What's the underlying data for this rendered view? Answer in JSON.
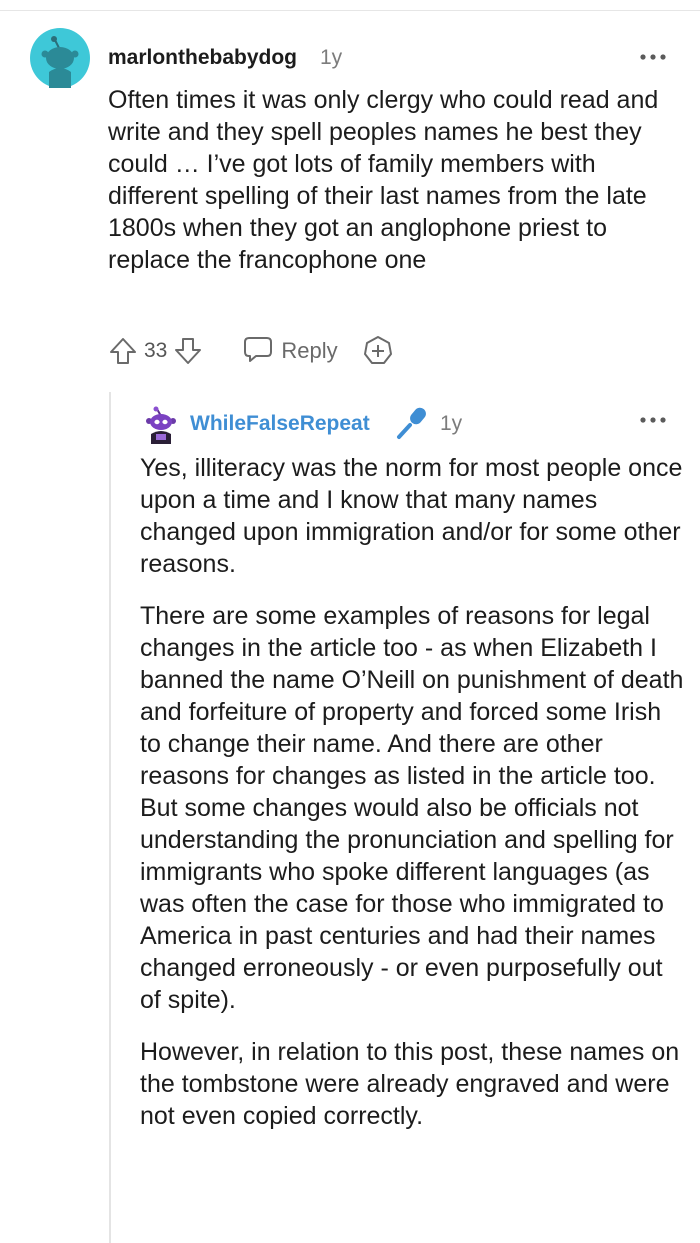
{
  "comment": {
    "avatar_icon": "snoo-avatar-icon",
    "avatar_color": "#3ec8d8",
    "username": "marlonthebabydog",
    "age": "1y",
    "more_icon": "more-options-icon",
    "body": "Often times it was only clergy who could read and write and they spell peoples names he best they could … I’ve got lots of family members with different spelling of their last names from the late 1800s when they got an anglophone priest to replace the francophone one",
    "upvote_icon": "upvote-arrow-icon",
    "vote_count": "33",
    "downvote_icon": "downvote-arrow-icon",
    "reply_icon": "speech-bubble-icon",
    "reply_label": "Reply",
    "award_icon": "award-plus-icon"
  },
  "reply": {
    "avatar_icon": "purple-snoo-avatar-icon",
    "username": "WhileFalseRepeat",
    "username_color": "#3f8ed4",
    "flair_icon": "microphone-icon",
    "age": "1y",
    "more_icon": "more-options-icon",
    "paragraphs": [
      "Yes, illiteracy was the norm for most people once upon a time and I know that many names changed upon immigration and/or for some other reasons.",
      "There are some examples of reasons for legal changes in the article too - as when Elizabeth I banned the name O’Neill on punishment of death and forfeiture of property and forced some Irish to change their name. And there are other reasons for changes as listed in the article too. But some changes would also be officials not understanding the pronunciation and spelling for immigrants who spoke different languages (as was often the case for those who immigrated to America in past centuries and had their names changed erroneously - or even purposefully out of spite).",
      "However, in relation to this post, these names on the tombstone were already engraved and were not even copied correctly."
    ]
  }
}
